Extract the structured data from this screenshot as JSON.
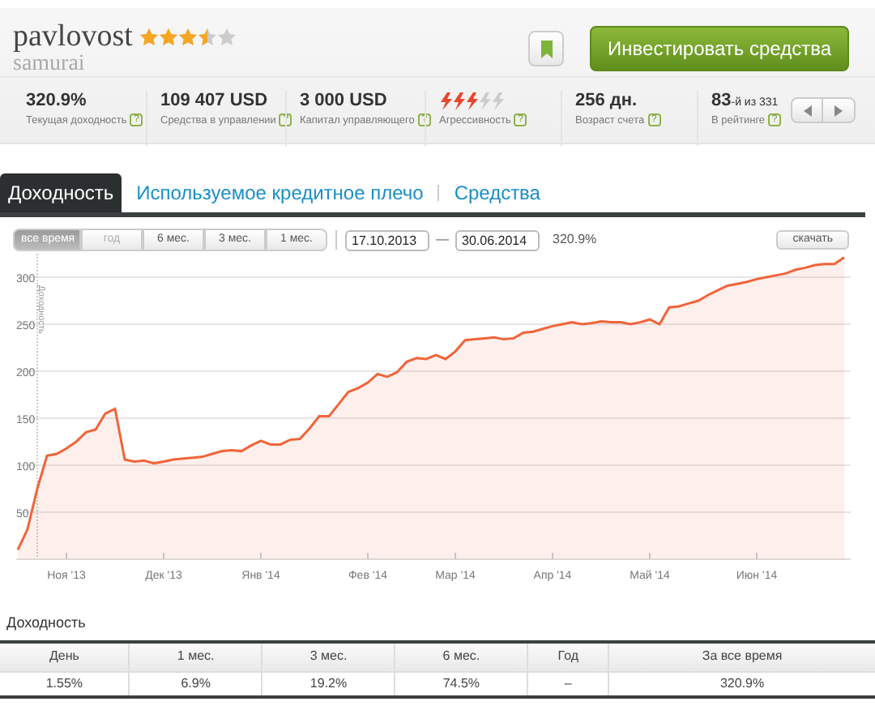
{
  "profile": {
    "name": "pavlovost",
    "stars": 3.5,
    "subtitle": "samurai"
  },
  "actions": {
    "invest": "Инвестировать средства"
  },
  "stats": [
    {
      "kind": "text",
      "value": "320.9%",
      "label": "Текущая доходность",
      "help": "?"
    },
    {
      "kind": "text",
      "value": "109 407 USD",
      "label": "Средства в управлении",
      "help": "?"
    },
    {
      "kind": "text",
      "value": "3 000 USD",
      "label": "Капитал управляющего",
      "help": "?"
    },
    {
      "kind": "meter",
      "level": 0.6,
      "label": "Агрессивность",
      "help": "?"
    },
    {
      "kind": "text",
      "value": "256 дн.",
      "label": "Возраст счета",
      "help": "?"
    },
    {
      "kind": "rank",
      "value": "83",
      "suffix": "-й из 331",
      "label": "В рейтинге",
      "help": "?"
    }
  ],
  "tabs": [
    {
      "label": "Доходность",
      "selected": true
    },
    {
      "label": "Используемое кредитное плечо",
      "selected": false
    },
    {
      "label": "Средства",
      "selected": false
    }
  ],
  "periods": [
    {
      "label": "все время",
      "selected": true,
      "disabled": false
    },
    {
      "label": "год",
      "selected": false,
      "disabled": true
    },
    {
      "label": "6 мес.",
      "selected": false,
      "disabled": false
    },
    {
      "label": "3 мес.",
      "selected": false,
      "disabled": false
    },
    {
      "label": "1 мес.",
      "selected": false,
      "disabled": false
    }
  ],
  "date_from": "17.10.2013",
  "date_sep": "—",
  "date_to": "30.06.2014",
  "total": "320.9%",
  "download": "скачать",
  "chart": {
    "chart_data": {
      "type": "area",
      "ylabel": "Доходность",
      "grid": true,
      "ylim": [
        0,
        325
      ],
      "categories": [
        null,
        null,
        null,
        null,
        null,
        "Ноя '13",
        null,
        null,
        null,
        null,
        null,
        null,
        null,
        null,
        null,
        "Дек '13",
        null,
        null,
        null,
        null,
        null,
        null,
        null,
        null,
        null,
        "Янв '14",
        null,
        null,
        null,
        null,
        null,
        null,
        null,
        null,
        null,
        null,
        "Фев '14",
        null,
        null,
        null,
        null,
        null,
        null,
        null,
        null,
        "Мар '14",
        null,
        null,
        null,
        null,
        null,
        null,
        null,
        null,
        null,
        "Апр '14",
        null,
        null,
        null,
        null,
        null,
        null,
        null,
        null,
        null,
        "Май '14",
        null,
        null,
        null,
        null,
        null,
        null,
        null,
        null,
        null,
        null,
        "Июн '14",
        null,
        null,
        null,
        null,
        null,
        null,
        null,
        null,
        null
      ],
      "series": [
        {
          "color": "#f0643a",
          "values": [
            10,
            32,
            75,
            110,
            112,
            118,
            125,
            135,
            138,
            155,
            160,
            106,
            104,
            105,
            102,
            104,
            106,
            107,
            108,
            109,
            112,
            115,
            116,
            115,
            121,
            126,
            122,
            122,
            127,
            128,
            139,
            152,
            152,
            165,
            178,
            182,
            188,
            197,
            194,
            199,
            210,
            214,
            213,
            217,
            213,
            221,
            233,
            234,
            235,
            236,
            234,
            235,
            241,
            242,
            245,
            248,
            250,
            252,
            250,
            251,
            253,
            252,
            252,
            250,
            252,
            255,
            250,
            268,
            269,
            272,
            275,
            281,
            286,
            291,
            293,
            295,
            298,
            300,
            302,
            304,
            308,
            310,
            313,
            314,
            314,
            321
          ]
        }
      ],
      "yticks": [
        50,
        100,
        150,
        200,
        250,
        300
      ]
    }
  },
  "returns": {
    "title": "Доходность",
    "columns": [
      "День",
      "1 мес.",
      "3 мес.",
      "6 мес.",
      "Год",
      "За все время"
    ],
    "rows": [
      [
        "1.55%",
        "6.9%",
        "19.2%",
        "74.5%",
        "–",
        "320.9%"
      ]
    ]
  }
}
